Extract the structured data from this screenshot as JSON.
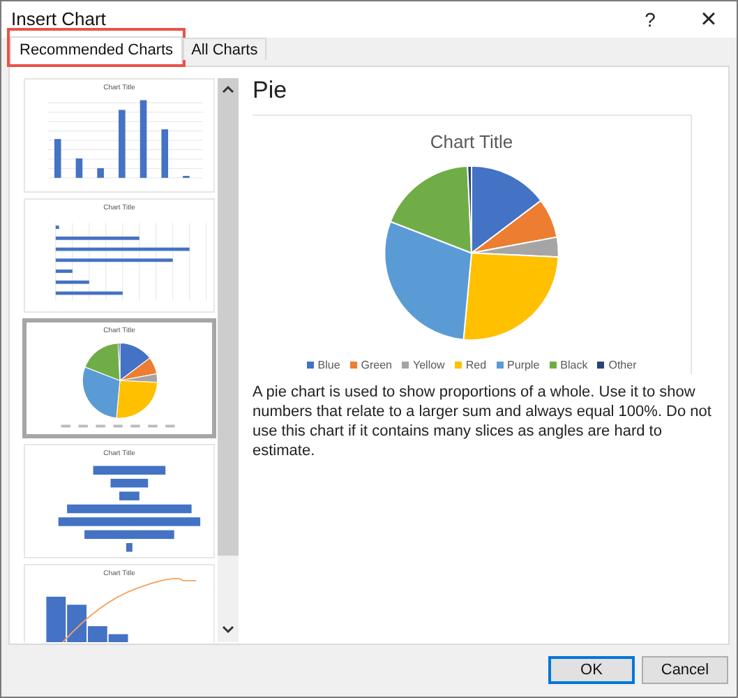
{
  "window": {
    "title": "Insert Chart",
    "help": "?",
    "close": "×"
  },
  "tabs": [
    {
      "label": "Recommended Charts",
      "selected": true,
      "highlighted": true
    },
    {
      "label": "All Charts",
      "selected": false,
      "highlighted": false
    }
  ],
  "thumbnails": [
    {
      "kind": "column",
      "title": "Chart Title",
      "selected": false
    },
    {
      "kind": "bar",
      "title": "Chart Title",
      "selected": false
    },
    {
      "kind": "pie",
      "title": "Chart Title",
      "selected": true
    },
    {
      "kind": "funnel",
      "title": "Chart Title",
      "selected": false
    },
    {
      "kind": "pareto",
      "title": "Chart Title",
      "selected": false
    }
  ],
  "preview": {
    "heading": "Pie",
    "chart_title": "Chart Title",
    "legend": [
      {
        "label": "Blue",
        "color": "#4472c4"
      },
      {
        "label": "Green",
        "color": "#ed7d31"
      },
      {
        "label": "Yellow",
        "color": "#a5a5a5"
      },
      {
        "label": "Red",
        "color": "#ffc000"
      },
      {
        "label": "Purple",
        "color": "#5b9bd5"
      },
      {
        "label": "Black",
        "color": "#70ad47"
      },
      {
        "label": "Other",
        "color": "#264478"
      }
    ],
    "description": "A pie chart is used to show proportions of a whole. Use it to show numbers that relate to a larger sum and always equal 100%. Do not use this chart if it contains many slices as angles are hard to estimate."
  },
  "buttons": [
    {
      "label": "OK",
      "default": true
    },
    {
      "label": "Cancel",
      "default": false
    }
  ]
}
